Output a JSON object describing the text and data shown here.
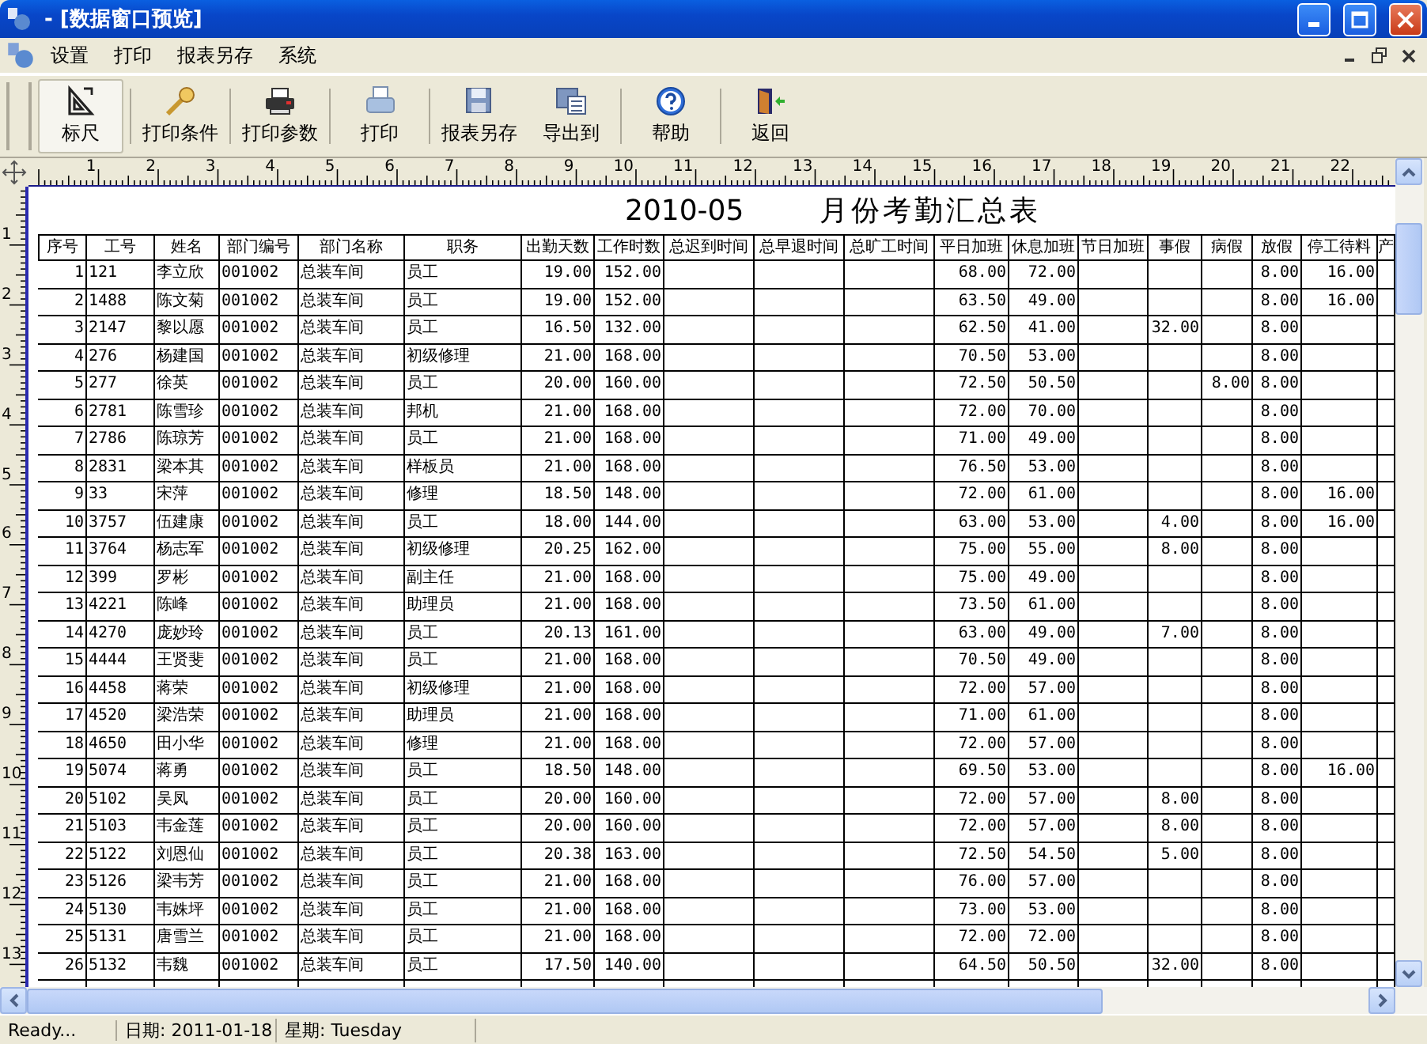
{
  "window": {
    "title": "- [数据窗口预览]"
  },
  "menu": [
    "设置",
    "打印",
    "报表另存",
    "系统"
  ],
  "toolbar": {
    "groups": [
      [
        {
          "label": "标尺",
          "selected": true
        }
      ],
      [
        {
          "label": "打印条件",
          "selected": false
        }
      ],
      [
        {
          "label": "打印参数",
          "selected": false
        }
      ],
      [
        {
          "label": "打印",
          "selected": false
        }
      ],
      [
        {
          "label": "报表另存",
          "selected": false
        },
        {
          "label": "导出到",
          "selected": false
        }
      ],
      [
        {
          "label": "帮助",
          "selected": false
        }
      ],
      [
        {
          "label": "返回",
          "selected": false
        }
      ]
    ]
  },
  "ruler": {
    "horizontal": [
      "1",
      "2",
      "3",
      "4",
      "5",
      "6",
      "7",
      "8",
      "9",
      "10",
      "11",
      "12",
      "13",
      "14",
      "15",
      "16",
      "17",
      "18",
      "19",
      "20",
      "21",
      "22"
    ],
    "vertical": [
      "1",
      "2",
      "3",
      "4",
      "5",
      "6",
      "7",
      "8",
      "9",
      "10",
      "11",
      "12",
      "13"
    ]
  },
  "report": {
    "period": "2010-05",
    "title": "月份考勤汇总表",
    "columns": [
      "序号",
      "工号",
      "姓名",
      "部门编号",
      "部门名称",
      "职务",
      "出勤天数",
      "工作时数",
      "总迟到时间",
      "总早退时间",
      "总旷工时间",
      "平日加班",
      "休息加班",
      "节日加班",
      "事假",
      "病假",
      "放假",
      "停工待料",
      "产"
    ],
    "rows": [
      [
        "1",
        "121",
        "李立欣",
        "001002",
        "总装车间",
        "员工",
        "19.00",
        "152.00",
        null,
        null,
        null,
        "68.00",
        "72.00",
        null,
        null,
        null,
        "8.00",
        "16.00",
        null
      ],
      [
        "2",
        "1488",
        "陈文菊",
        "001002",
        "总装车间",
        "员工",
        "19.00",
        "152.00",
        null,
        null,
        null,
        "63.50",
        "49.00",
        null,
        null,
        null,
        "8.00",
        "16.00",
        null
      ],
      [
        "3",
        "2147",
        "黎以愿",
        "001002",
        "总装车间",
        "员工",
        "16.50",
        "132.00",
        null,
        null,
        null,
        "62.50",
        "41.00",
        null,
        "32.00",
        null,
        "8.00",
        null,
        null
      ],
      [
        "4",
        "276",
        "杨建国",
        "001002",
        "总装车间",
        "初级修理",
        "21.00",
        "168.00",
        null,
        null,
        null,
        "70.50",
        "53.00",
        null,
        null,
        null,
        "8.00",
        null,
        null
      ],
      [
        "5",
        "277",
        "徐英",
        "001002",
        "总装车间",
        "员工",
        "20.00",
        "160.00",
        null,
        null,
        null,
        "72.50",
        "50.50",
        null,
        null,
        "8.00",
        "8.00",
        null,
        null
      ],
      [
        "6",
        "2781",
        "陈雪珍",
        "001002",
        "总装车间",
        "邦机",
        "21.00",
        "168.00",
        null,
        null,
        null,
        "72.00",
        "70.00",
        null,
        null,
        null,
        "8.00",
        null,
        null
      ],
      [
        "7",
        "2786",
        "陈琼芳",
        "001002",
        "总装车间",
        "员工",
        "21.00",
        "168.00",
        null,
        null,
        null,
        "71.00",
        "49.00",
        null,
        null,
        null,
        "8.00",
        null,
        null
      ],
      [
        "8",
        "2831",
        "梁本其",
        "001002",
        "总装车间",
        "样板员",
        "21.00",
        "168.00",
        null,
        null,
        null,
        "76.50",
        "53.00",
        null,
        null,
        null,
        "8.00",
        null,
        null
      ],
      [
        "9",
        "33",
        "宋萍",
        "001002",
        "总装车间",
        "修理",
        "18.50",
        "148.00",
        null,
        null,
        null,
        "72.00",
        "61.00",
        null,
        null,
        null,
        "8.00",
        "16.00",
        null
      ],
      [
        "10",
        "3757",
        "伍建康",
        "001002",
        "总装车间",
        "员工",
        "18.00",
        "144.00",
        null,
        null,
        null,
        "63.00",
        "53.00",
        null,
        "4.00",
        null,
        "8.00",
        "16.00",
        null
      ],
      [
        "11",
        "3764",
        "杨志军",
        "001002",
        "总装车间",
        "初级修理",
        "20.25",
        "162.00",
        null,
        null,
        null,
        "75.00",
        "55.00",
        null,
        "8.00",
        null,
        "8.00",
        null,
        null
      ],
      [
        "12",
        "399",
        "罗彬",
        "001002",
        "总装车间",
        "副主任",
        "21.00",
        "168.00",
        null,
        null,
        null,
        "75.00",
        "49.00",
        null,
        null,
        null,
        "8.00",
        null,
        null
      ],
      [
        "13",
        "4221",
        "陈峰",
        "001002",
        "总装车间",
        "助理员",
        "21.00",
        "168.00",
        null,
        null,
        null,
        "73.50",
        "61.00",
        null,
        null,
        null,
        "8.00",
        null,
        null
      ],
      [
        "14",
        "4270",
        "庞妙玲",
        "001002",
        "总装车间",
        "员工",
        "20.13",
        "161.00",
        null,
        null,
        null,
        "63.00",
        "49.00",
        null,
        "7.00",
        null,
        "8.00",
        null,
        null
      ],
      [
        "15",
        "4444",
        "王贤斐",
        "001002",
        "总装车间",
        "员工",
        "21.00",
        "168.00",
        null,
        null,
        null,
        "70.50",
        "49.00",
        null,
        null,
        null,
        "8.00",
        null,
        null
      ],
      [
        "16",
        "4458",
        "蒋荣",
        "001002",
        "总装车间",
        "初级修理",
        "21.00",
        "168.00",
        null,
        null,
        null,
        "72.00",
        "57.00",
        null,
        null,
        null,
        "8.00",
        null,
        null
      ],
      [
        "17",
        "4520",
        "梁浩荣",
        "001002",
        "总装车间",
        "助理员",
        "21.00",
        "168.00",
        null,
        null,
        null,
        "71.00",
        "61.00",
        null,
        null,
        null,
        "8.00",
        null,
        null
      ],
      [
        "18",
        "4650",
        "田小华",
        "001002",
        "总装车间",
        "修理",
        "21.00",
        "168.00",
        null,
        null,
        null,
        "72.00",
        "57.00",
        null,
        null,
        null,
        "8.00",
        null,
        null
      ],
      [
        "19",
        "5074",
        "蒋勇",
        "001002",
        "总装车间",
        "员工",
        "18.50",
        "148.00",
        null,
        null,
        null,
        "69.50",
        "53.00",
        null,
        null,
        null,
        "8.00",
        "16.00",
        null
      ],
      [
        "20",
        "5102",
        "吴凤",
        "001002",
        "总装车间",
        "员工",
        "20.00",
        "160.00",
        null,
        null,
        null,
        "72.00",
        "57.00",
        null,
        "8.00",
        null,
        "8.00",
        null,
        null
      ],
      [
        "21",
        "5103",
        "韦金莲",
        "001002",
        "总装车间",
        "员工",
        "20.00",
        "160.00",
        null,
        null,
        null,
        "72.00",
        "57.00",
        null,
        "8.00",
        null,
        "8.00",
        null,
        null
      ],
      [
        "22",
        "5122",
        "刘恩仙",
        "001002",
        "总装车间",
        "员工",
        "20.38",
        "163.00",
        null,
        null,
        null,
        "72.50",
        "54.50",
        null,
        "5.00",
        null,
        "8.00",
        null,
        null
      ],
      [
        "23",
        "5126",
        "梁韦芳",
        "001002",
        "总装车间",
        "员工",
        "21.00",
        "168.00",
        null,
        null,
        null,
        "76.00",
        "57.00",
        null,
        null,
        null,
        "8.00",
        null,
        null
      ],
      [
        "24",
        "5130",
        "韦姝坪",
        "001002",
        "总装车间",
        "员工",
        "21.00",
        "168.00",
        null,
        null,
        null,
        "73.00",
        "53.00",
        null,
        null,
        null,
        "8.00",
        null,
        null
      ],
      [
        "25",
        "5131",
        "唐雪兰",
        "001002",
        "总装车间",
        "员工",
        "21.00",
        "168.00",
        null,
        null,
        null,
        "72.00",
        "72.00",
        null,
        null,
        null,
        "8.00",
        null,
        null
      ],
      [
        "26",
        "5132",
        "韦魏",
        "001002",
        "总装车间",
        "员工",
        "17.50",
        "140.00",
        null,
        null,
        null,
        "64.50",
        "50.50",
        null,
        "32.00",
        null,
        "8.00",
        null,
        null
      ]
    ]
  },
  "status_bar": [
    "Ready...",
    "日期: 2011-01-18",
    "星期: Tuesday"
  ]
}
